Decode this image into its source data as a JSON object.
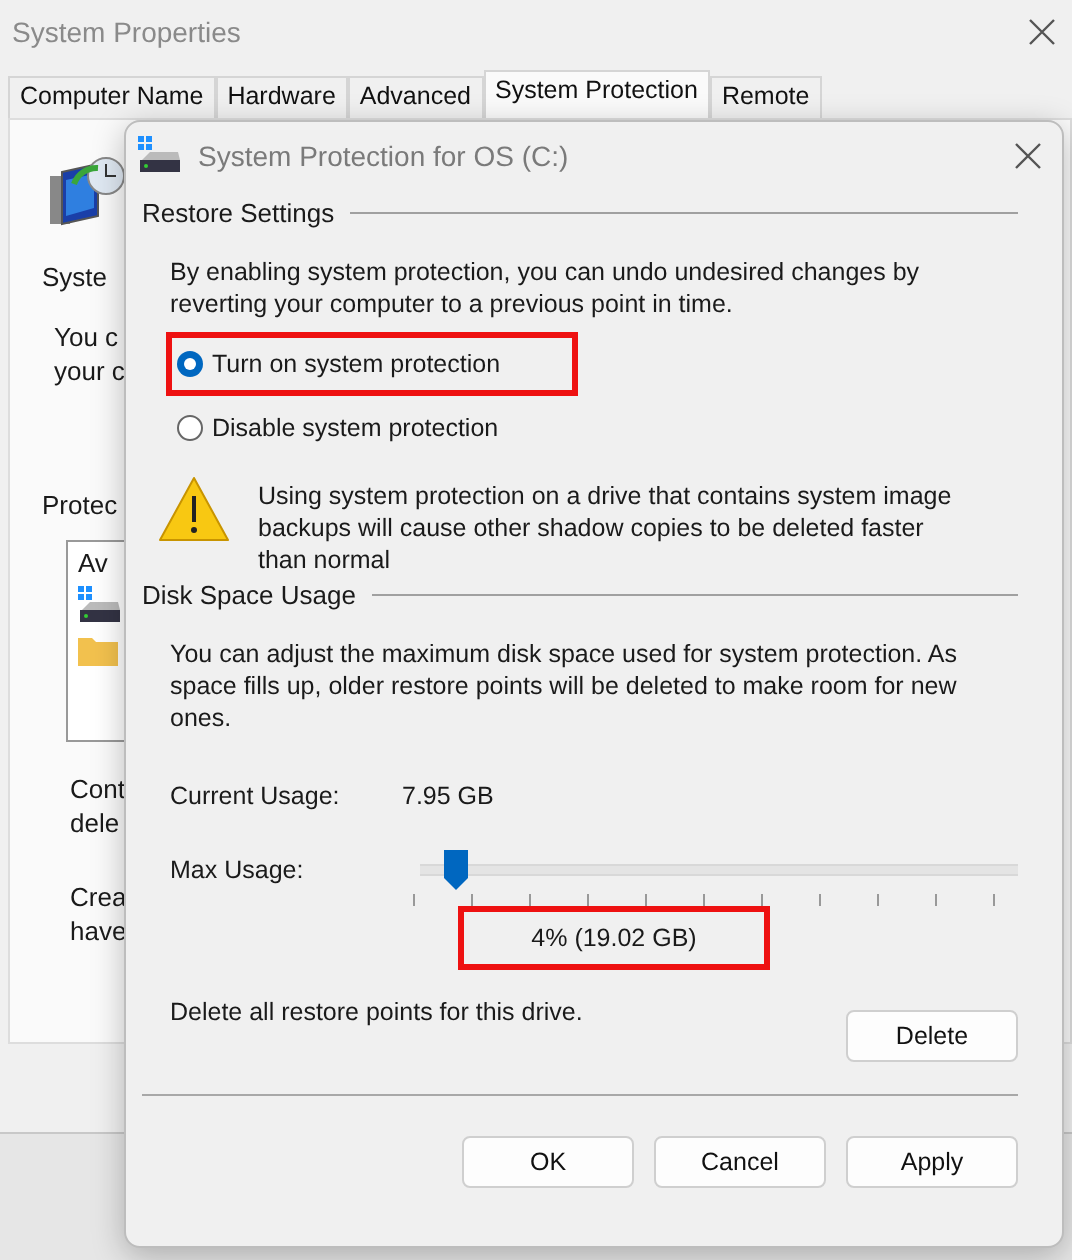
{
  "background_window": {
    "title": "System Properties",
    "tabs": [
      {
        "label": "Computer Name",
        "selected": false
      },
      {
        "label": "Hardware",
        "selected": false
      },
      {
        "label": "Advanced",
        "selected": false
      },
      {
        "label": "System Protection",
        "selected": true
      },
      {
        "label": "Remote",
        "selected": false
      }
    ],
    "panel": {
      "heading": "Syste",
      "description_lines": [
        "You c",
        "your c"
      ],
      "protection_label": "Protec",
      "list_header": "Av",
      "configure_lines": [
        "Cont",
        "dele"
      ],
      "create_lines": [
        "Crea",
        "have"
      ]
    }
  },
  "dialog": {
    "title": "System Protection for OS (C:)",
    "restore_settings": {
      "heading": "Restore Settings",
      "description": "By enabling system protection, you can undo undesired changes by reverting your computer to a previous point in time.",
      "options": [
        {
          "label": "Turn on system protection",
          "selected": true,
          "highlighted": true
        },
        {
          "label": "Disable system protection",
          "selected": false,
          "highlighted": false
        }
      ],
      "warning": "Using system protection on a drive that contains system image backups will cause other shadow copies to be deleted faster than normal"
    },
    "disk_space": {
      "heading": "Disk Space Usage",
      "description": "You can adjust the maximum disk space used for system protection. As space fills up, older restore points will be deleted to make room for new ones.",
      "current_usage_label": "Current Usage:",
      "current_usage_value": "7.95 GB",
      "max_usage_label": "Max Usage:",
      "slider": {
        "level": 0.04
      },
      "reading": {
        "text": "4% (19.02 GB)",
        "highlighted": true
      },
      "delete_text": "Delete all restore points for this drive.",
      "delete_button": "Delete"
    },
    "buttons": [
      "OK",
      "Cancel",
      "Apply"
    ]
  }
}
